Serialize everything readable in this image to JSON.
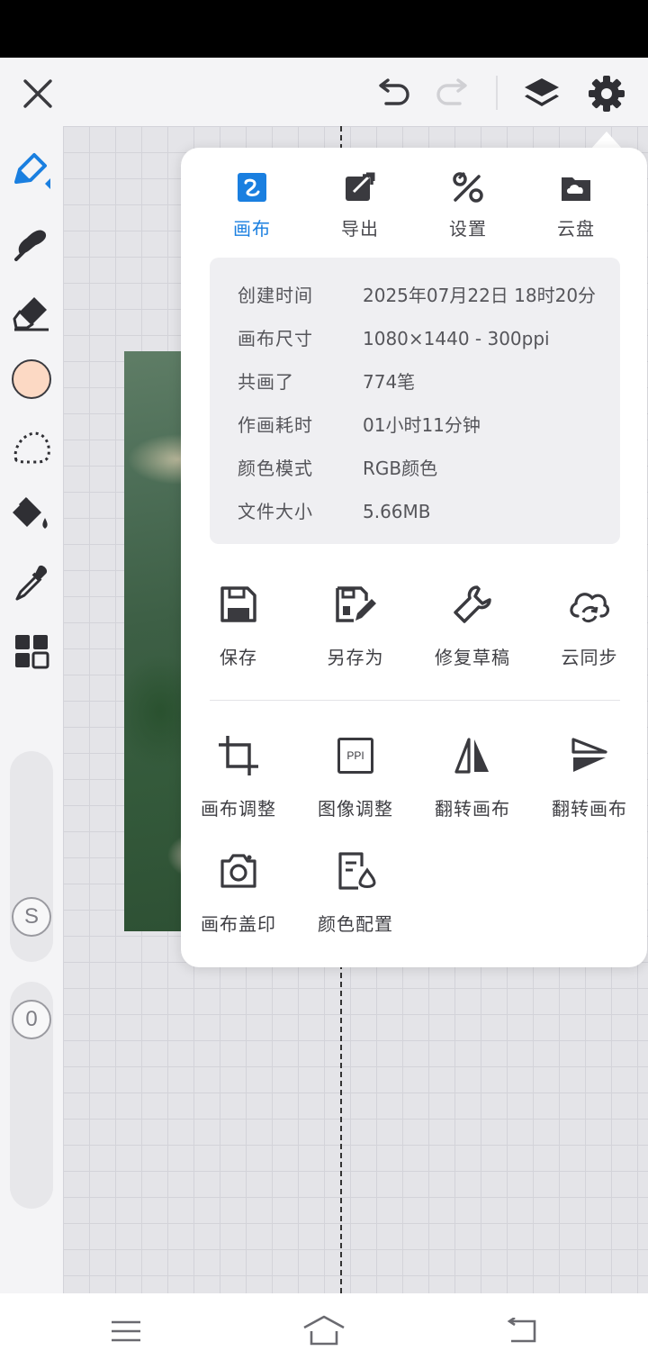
{
  "toolbar": {
    "close_icon": "close-icon",
    "undo_icon": "undo-icon",
    "redo_icon": "redo-icon",
    "layers_icon": "layers-icon",
    "settings_icon": "gear-icon"
  },
  "tools": [
    "brush",
    "smudge",
    "eraser",
    "color",
    "lasso",
    "fill",
    "eyedropper",
    "grid"
  ],
  "color_swatch": "#fcd9c4",
  "accent_color": "#1a7fe0",
  "sliders": {
    "size_label": "S",
    "opacity_label": "0"
  },
  "menu": {
    "tabs": [
      {
        "label": "画布",
        "icon": "canvas-icon",
        "active": true
      },
      {
        "label": "导出",
        "icon": "export-icon",
        "active": false
      },
      {
        "label": "设置",
        "icon": "settings-icon",
        "active": false
      },
      {
        "label": "云盘",
        "icon": "cloud-drive-icon",
        "active": false
      }
    ],
    "info": [
      {
        "key": "创建时间",
        "value": "2025年07月22日 18时20分"
      },
      {
        "key": "画布尺寸",
        "value": "1080×1440 - 300ppi"
      },
      {
        "key": "共画了",
        "value": "774笔"
      },
      {
        "key": "作画耗时",
        "value": "01小时11分钟"
      },
      {
        "key": "颜色模式",
        "value": "RGB颜色"
      },
      {
        "key": "文件大小",
        "value": "5.66MB"
      }
    ],
    "actions_row1": [
      {
        "label": "保存",
        "icon": "save-icon"
      },
      {
        "label": "另存为",
        "icon": "save-as-icon"
      },
      {
        "label": "修复草稿",
        "icon": "repair-icon"
      },
      {
        "label": "云同步",
        "icon": "cloud-sync-icon"
      }
    ],
    "actions_row2": [
      {
        "label": "画布调整",
        "icon": "crop-icon"
      },
      {
        "label": "图像调整",
        "icon": "ppi-icon",
        "icon_text": "PPI"
      },
      {
        "label": "翻转画布",
        "icon": "flip-horizontal-icon"
      },
      {
        "label": "翻转画布",
        "icon": "flip-vertical-icon"
      }
    ],
    "actions_row3": [
      {
        "label": "画布盖印",
        "icon": "camera-icon"
      },
      {
        "label": "颜色配置",
        "icon": "color-profile-icon"
      }
    ]
  },
  "nav": {
    "menu_icon": "menu-icon",
    "home_icon": "home-icon",
    "back_icon": "back-icon"
  }
}
